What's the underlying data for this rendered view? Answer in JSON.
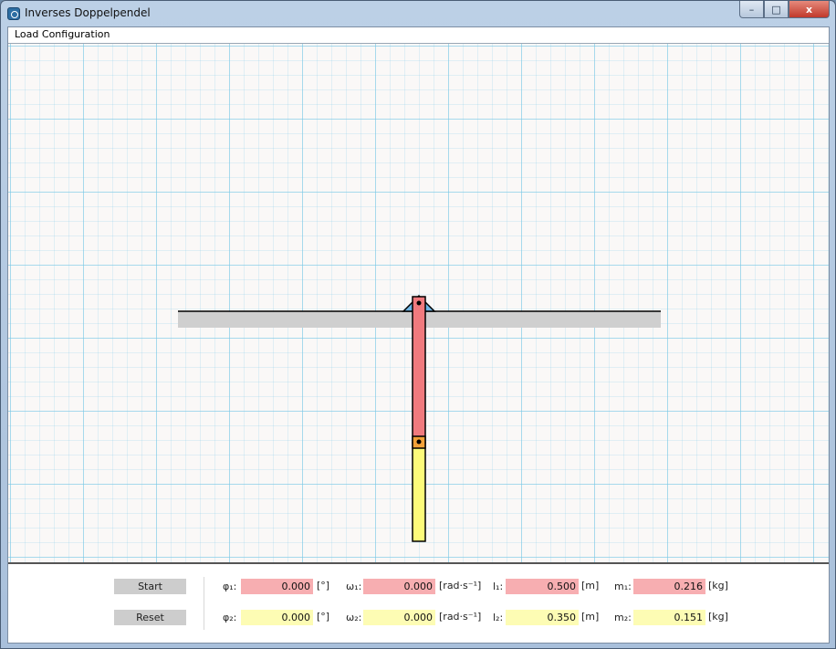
{
  "window": {
    "title": "Inverses Doppelpendel",
    "controls": {
      "minimize": "–",
      "maximize": "□",
      "close": "x"
    }
  },
  "menu": {
    "load_configuration": "Load Configuration"
  },
  "controls": {
    "start_label": "Start",
    "reset_label": "Reset"
  },
  "params": {
    "phi1": {
      "label": "φ₁:",
      "value": "0.000",
      "unit": "[°]"
    },
    "phi2": {
      "label": "φ₂:",
      "value": "0.000",
      "unit": "[°]"
    },
    "omega1": {
      "label": "ω₁:",
      "value": "0.000",
      "unit": "[rad·s⁻¹]"
    },
    "omega2": {
      "label": "ω₂:",
      "value": "0.000",
      "unit": "[rad·s⁻¹]"
    },
    "l1": {
      "label": "l₁:",
      "value": "0.500",
      "unit": "[m]"
    },
    "l2": {
      "label": "l₂:",
      "value": "0.350",
      "unit": "[m]"
    },
    "m1": {
      "label": "m₁:",
      "value": "0.216",
      "unit": "[kg]"
    },
    "m2": {
      "label": "m₂:",
      "value": "0.151",
      "unit": "[kg]"
    }
  },
  "colors": {
    "segment1": "#f07a7e",
    "segment2": "#fdfb7a",
    "joint": "#f3a23a",
    "pivot": "#6fb6e6",
    "rail_shadow": "#cfcfcf"
  }
}
